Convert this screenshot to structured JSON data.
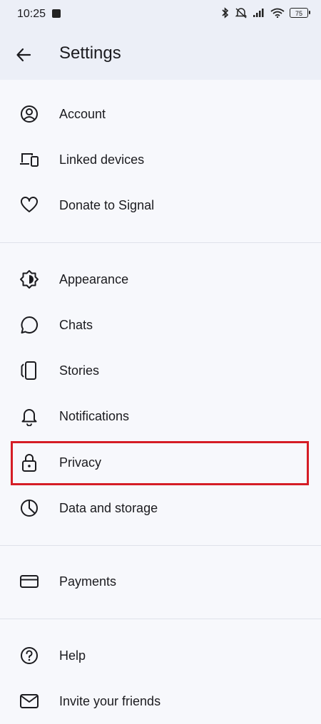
{
  "status": {
    "time": "10:25",
    "battery": "75"
  },
  "header": {
    "title": "Settings"
  },
  "items": [
    {
      "label": "Account",
      "icon": "account-icon"
    },
    {
      "label": "Linked devices",
      "icon": "linked-devices-icon"
    },
    {
      "label": "Donate to Signal",
      "icon": "heart-icon"
    },
    {
      "label": "Appearance",
      "icon": "appearance-icon"
    },
    {
      "label": "Chats",
      "icon": "chat-icon"
    },
    {
      "label": "Stories",
      "icon": "stories-icon"
    },
    {
      "label": "Notifications",
      "icon": "bell-icon"
    },
    {
      "label": "Privacy",
      "icon": "lock-icon"
    },
    {
      "label": "Data and storage",
      "icon": "pie-chart-icon"
    },
    {
      "label": "Payments",
      "icon": "card-icon"
    },
    {
      "label": "Help",
      "icon": "help-icon"
    },
    {
      "label": "Invite your friends",
      "icon": "mail-icon"
    }
  ],
  "colors": {
    "background": "#f7f8fc",
    "header": "#eceff7",
    "highlight": "#d51d26",
    "text": "#1b1b1f"
  }
}
